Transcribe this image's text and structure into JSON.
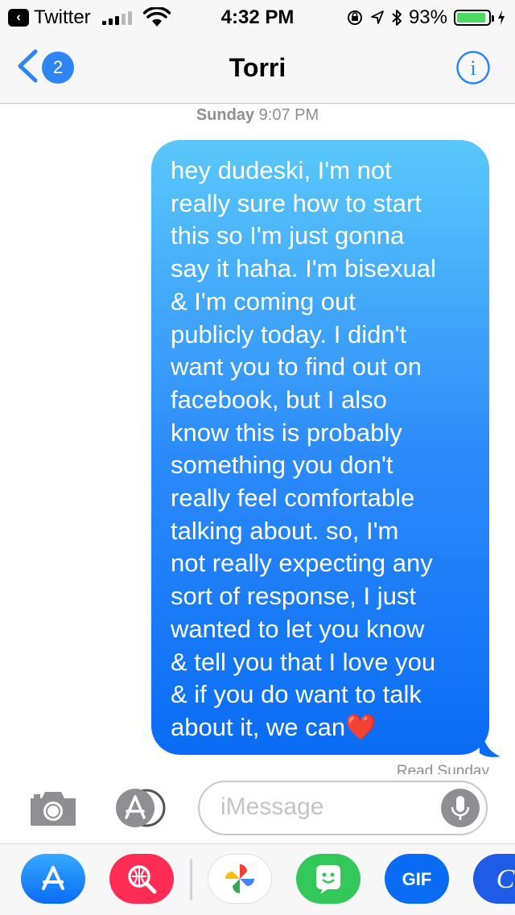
{
  "status_bar": {
    "back_app": "Twitter",
    "time": "4:32 PM",
    "battery_pct": "93%",
    "battery_level": 0.93
  },
  "nav": {
    "badge": "2",
    "title": "Torri",
    "info_icon": "info-icon"
  },
  "conversation": {
    "timestamp_day": "Sunday",
    "timestamp_time": "9:07 PM",
    "message": "hey dudeski, I'm not\nreally sure how to start\nthis so I'm just gonna\nsay it haha. I'm bisexual\n& I'm coming out\npublicly today. I didn't\nwant you to find out on\nfacebook, but I also\nknow this is probably\nsomething you don't\nreally feel comfortable\ntalking about. so, I'm\nnot really expecting any\nsort of response, I just\nwanted to let you know\n& tell you that I love you\n& if you do want to talk\nabout it, we can",
    "heart": "❤️",
    "read_receipt": "Read Sunday"
  },
  "input": {
    "placeholder": "iMessage"
  },
  "drawer_icons": [
    "app-store-icon",
    "web-search-icon",
    "photos-icon",
    "bitmoji-icon",
    "gif-icon",
    "c-app-icon"
  ],
  "colors": {
    "accent": "#2e86f5",
    "bubble_top": "#5ac8fa",
    "bubble_bottom": "#0a6cf5"
  }
}
